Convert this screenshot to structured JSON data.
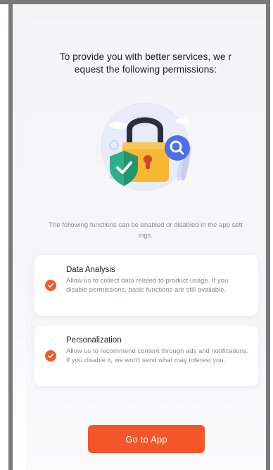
{
  "permissions_prompt": {
    "title_line1": "To provide you with better services, we r",
    "title_line2": "equest the following permissions:",
    "subtitle_line1": "The following functions can be enabled or disabled in the app sett",
    "subtitle_line2": "ings.",
    "items": [
      {
        "title": "Data Analysis",
        "description": "Allow us to collect data related to product usage. If you disable permissions, basic functions are still available."
      },
      {
        "title": "Personalization",
        "description": "Allow us to recommend content through ads and notifications. If you disable it, we won't send what may interest you."
      }
    ],
    "primary_button_label": "Go to App"
  },
  "colors": {
    "accent": "#f4562a",
    "background": "#f4f5f7",
    "text_primary": "#1b1b1b",
    "text_secondary": "#8a8d93",
    "lock_body": "#f7b733",
    "shield": "#33b08c",
    "magnifier": "#4b6fe6"
  },
  "icons": {
    "illustration": "lock-with-shield-and-magnifier-icon",
    "item_check": "check-circle-icon"
  }
}
